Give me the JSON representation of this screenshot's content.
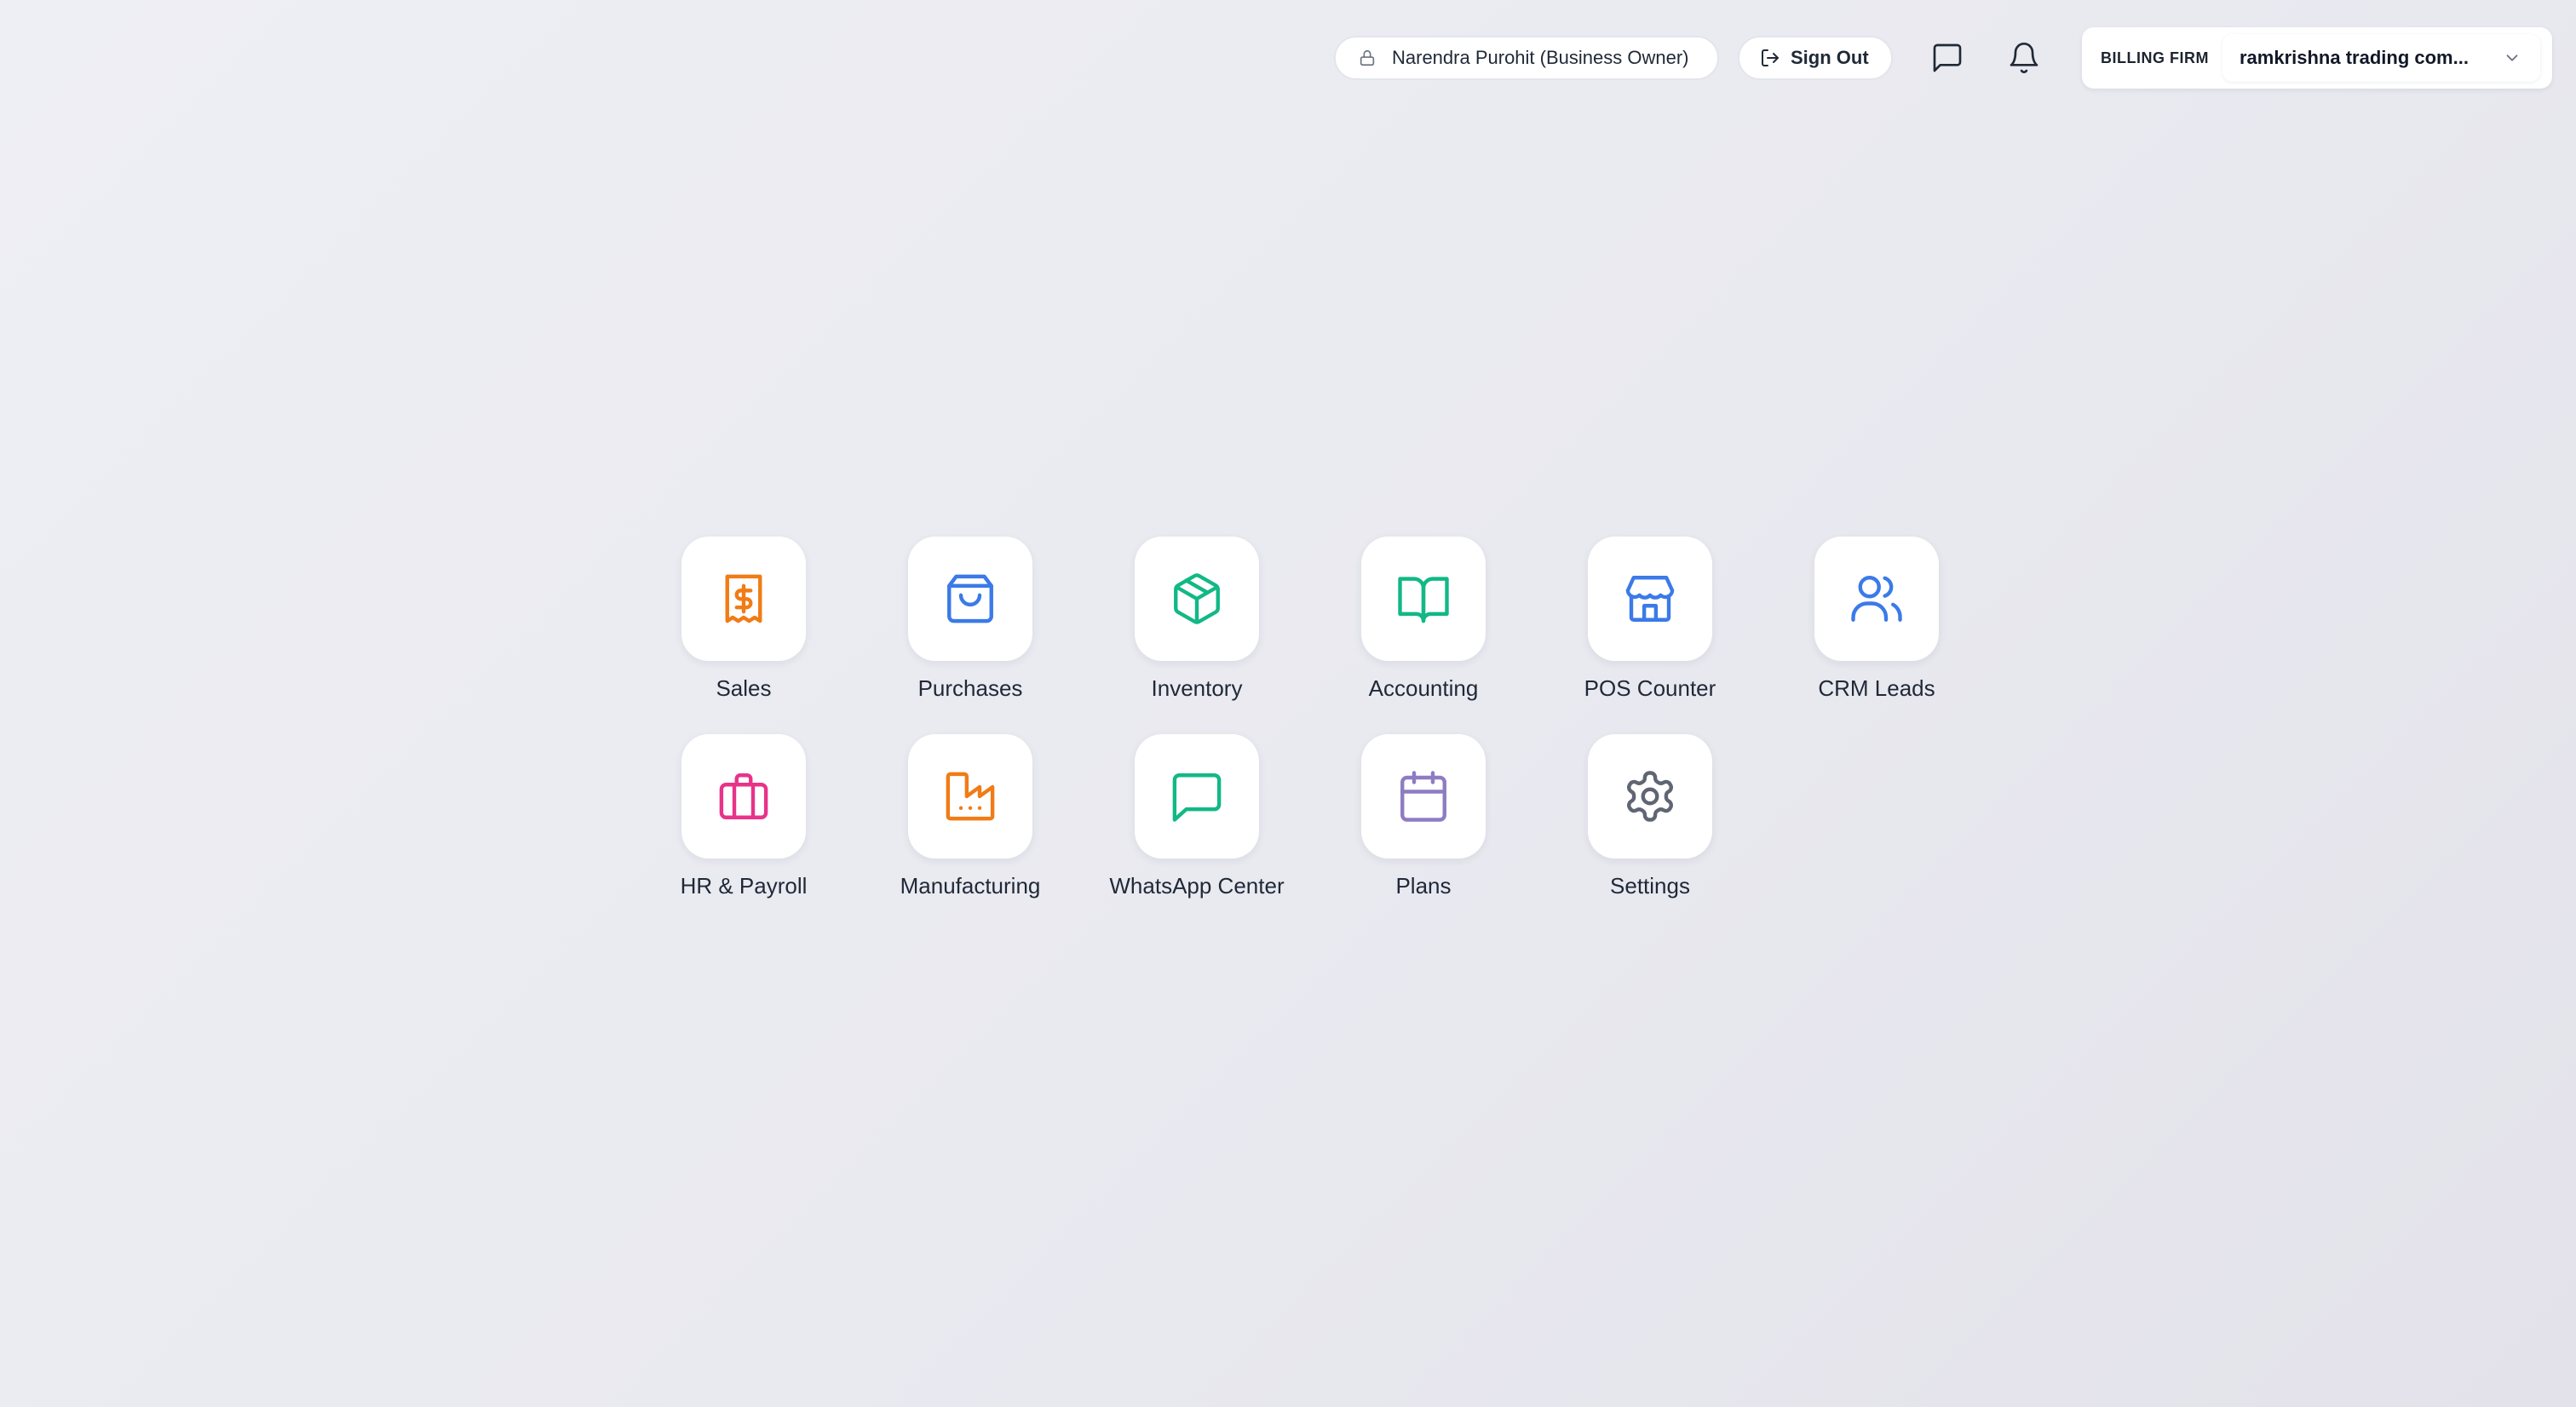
{
  "header": {
    "user_label": "Narendra Purohit (Business Owner)",
    "sign_out_label": "Sign Out",
    "billing_firm_label": "BILLING FIRM",
    "billing_firm_value": "ramkrishna trading com...",
    "icons": [
      "lock-icon",
      "sign-out-icon",
      "chat-icon",
      "bell-icon",
      "chevron-down-icon"
    ]
  },
  "apps": [
    {
      "label": "Sales",
      "icon": "receipt-dollar-icon",
      "color": "#f07c16"
    },
    {
      "label": "Purchases",
      "icon": "shopping-bag-icon",
      "color": "#3b7ae8"
    },
    {
      "label": "Inventory",
      "icon": "package-box-icon",
      "color": "#12b886"
    },
    {
      "label": "Accounting",
      "icon": "open-book-icon",
      "color": "#12b886"
    },
    {
      "label": "POS Counter",
      "icon": "storefront-icon",
      "color": "#3b7ae8"
    },
    {
      "label": "CRM Leads",
      "icon": "users-icon",
      "color": "#3b7ae8"
    },
    {
      "label": "HR & Payroll",
      "icon": "briefcase-icon",
      "color": "#e8338a"
    },
    {
      "label": "Manufacturing",
      "icon": "factory-icon",
      "color": "#f07c16"
    },
    {
      "label": "WhatsApp Center",
      "icon": "message-square-icon",
      "color": "#12b886"
    },
    {
      "label": "Plans",
      "icon": "calendar-icon",
      "color": "#8e7cc3"
    },
    {
      "label": "Settings",
      "icon": "gear-icon",
      "color": "#5f6573"
    }
  ]
}
